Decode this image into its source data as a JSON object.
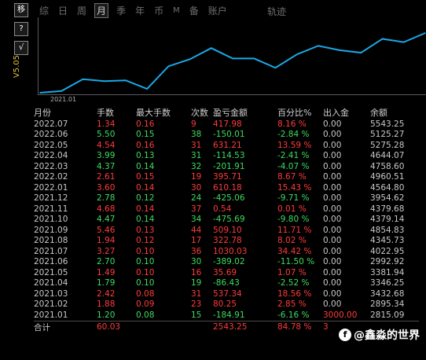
{
  "toolbar": {
    "move_label": "移",
    "help_label": "?",
    "check_label": "√",
    "version": "V5.05"
  },
  "tabs": [
    {
      "label": "综",
      "active": false
    },
    {
      "label": "日",
      "active": false
    },
    {
      "label": "周",
      "active": false
    },
    {
      "label": "月",
      "active": true
    },
    {
      "label": "季",
      "active": false
    },
    {
      "label": "年",
      "active": false
    },
    {
      "label": "币",
      "active": false
    },
    {
      "label": "M",
      "active": false
    },
    {
      "label": "备",
      "active": false
    },
    {
      "label": "账户",
      "active": false
    }
  ],
  "track_label": "轨迹",
  "chart_data": {
    "type": "line",
    "xtick_label": "2021.01",
    "x": [
      "2021.01",
      "2021.02",
      "2021.03",
      "2021.04",
      "2021.05",
      "2021.06",
      "2021.07",
      "2021.08",
      "2021.09",
      "2021.10",
      "2021.11",
      "2021.12",
      "2022.01",
      "2022.02",
      "2022.03",
      "2022.04",
      "2022.05",
      "2022.06",
      "2022.07"
    ],
    "values": [
      2815.09,
      2895.34,
      3432.68,
      3346.25,
      3381.94,
      2992.92,
      4022.95,
      4345.73,
      4854.83,
      4379.14,
      4379.68,
      3954.62,
      4564.8,
      4960.51,
      4758.6,
      4644.07,
      5275.28,
      5125.27,
      5543.25
    ],
    "color": "#1aa8e6"
  },
  "table": {
    "headers": [
      "月份",
      "手数",
      "最大手数",
      "次数",
      "盈亏金额",
      "百分比%",
      "出入金",
      "余额"
    ],
    "rows": [
      {
        "month": "2022.07",
        "lots": "1.34",
        "max": "0.16",
        "count": "9",
        "pnl": "417.98",
        "pct": "8.16 %",
        "flow": "0.00",
        "balance": "5543.25",
        "pos": true
      },
      {
        "month": "2022.06",
        "lots": "5.50",
        "max": "0.15",
        "count": "38",
        "pnl": "-150.01",
        "pct": "-2.84 %",
        "flow": "0.00",
        "balance": "5125.27",
        "pos": false
      },
      {
        "month": "2022.05",
        "lots": "4.54",
        "max": "0.16",
        "count": "31",
        "pnl": "631.21",
        "pct": "13.59 %",
        "flow": "0.00",
        "balance": "5275.28",
        "pos": true
      },
      {
        "month": "2022.04",
        "lots": "3.99",
        "max": "0.13",
        "count": "31",
        "pnl": "-114.53",
        "pct": "-2.41 %",
        "flow": "0.00",
        "balance": "4644.07",
        "pos": false
      },
      {
        "month": "2022.03",
        "lots": "4.37",
        "max": "0.14",
        "count": "32",
        "pnl": "-201.91",
        "pct": "-4.07 %",
        "flow": "0.00",
        "balance": "4758.60",
        "pos": false
      },
      {
        "month": "2022.02",
        "lots": "2.61",
        "max": "0.15",
        "count": "19",
        "pnl": "395.71",
        "pct": "8.67 %",
        "flow": "0.00",
        "balance": "4960.51",
        "pos": true
      },
      {
        "month": "2022.01",
        "lots": "3.60",
        "max": "0.14",
        "count": "30",
        "pnl": "610.18",
        "pct": "15.43 %",
        "flow": "0.00",
        "balance": "4564.80",
        "pos": true
      },
      {
        "month": "2021.12",
        "lots": "2.78",
        "max": "0.12",
        "count": "24",
        "pnl": "-425.06",
        "pct": "-9.71 %",
        "flow": "0.00",
        "balance": "3954.62",
        "pos": false
      },
      {
        "month": "2021.11",
        "lots": "4.68",
        "max": "0.14",
        "count": "37",
        "pnl": "0.54",
        "pct": "0.01 %",
        "flow": "0.00",
        "balance": "4379.68",
        "pos": true
      },
      {
        "month": "2021.10",
        "lots": "4.47",
        "max": "0.14",
        "count": "34",
        "pnl": "-475.69",
        "pct": "-9.80 %",
        "flow": "0.00",
        "balance": "4379.14",
        "pos": false
      },
      {
        "month": "2021.09",
        "lots": "5.46",
        "max": "0.13",
        "count": "44",
        "pnl": "509.10",
        "pct": "11.71 %",
        "flow": "0.00",
        "balance": "4854.83",
        "pos": true
      },
      {
        "month": "2021.08",
        "lots": "1.94",
        "max": "0.12",
        "count": "17",
        "pnl": "322.78",
        "pct": "8.02 %",
        "flow": "0.00",
        "balance": "4345.73",
        "pos": true
      },
      {
        "month": "2021.07",
        "lots": "3.27",
        "max": "0.10",
        "count": "36",
        "pnl": "1030.03",
        "pct": "34.42 %",
        "flow": "0.00",
        "balance": "4022.95",
        "pos": true
      },
      {
        "month": "2021.06",
        "lots": "2.70",
        "max": "0.10",
        "count": "30",
        "pnl": "-389.02",
        "pct": "-11.50 %",
        "flow": "0.00",
        "balance": "2992.92",
        "pos": false
      },
      {
        "month": "2021.05",
        "lots": "1.49",
        "max": "0.10",
        "count": "16",
        "pnl": "35.69",
        "pct": "1.07 %",
        "flow": "0.00",
        "balance": "3381.94",
        "pos": true
      },
      {
        "month": "2021.04",
        "lots": "1.79",
        "max": "0.10",
        "count": "19",
        "pnl": "-86.43",
        "pct": "-2.52 %",
        "flow": "0.00",
        "balance": "3346.25",
        "pos": false
      },
      {
        "month": "2021.03",
        "lots": "2.42",
        "max": "0.08",
        "count": "31",
        "pnl": "537.34",
        "pct": "18.56 %",
        "flow": "0.00",
        "balance": "3432.68",
        "pos": true
      },
      {
        "month": "2021.02",
        "lots": "1.88",
        "max": "0.09",
        "count": "23",
        "pnl": "80.25",
        "pct": "2.85 %",
        "flow": "0.00",
        "balance": "2895.34",
        "pos": true
      },
      {
        "month": "2021.01",
        "lots": "1.20",
        "max": "0.08",
        "count": "15",
        "pnl": "-184.91",
        "pct": "-6.16 %",
        "flow": "3000.00",
        "balance": "2815.09",
        "pos": false
      }
    ],
    "total": {
      "month": "合计",
      "lots": "60.03",
      "max": "",
      "count": "",
      "pnl": "2543.25",
      "pct": "84.78 %",
      "flow": "3",
      "balance": ""
    }
  },
  "watermark": {
    "icon": "facebook-icon",
    "text": "@鑫淼的世界"
  },
  "colors": {
    "positive": "#ff3b3b",
    "negative": "#3ddc5f",
    "line": "#1aa8e6",
    "version": "#e0c040"
  }
}
